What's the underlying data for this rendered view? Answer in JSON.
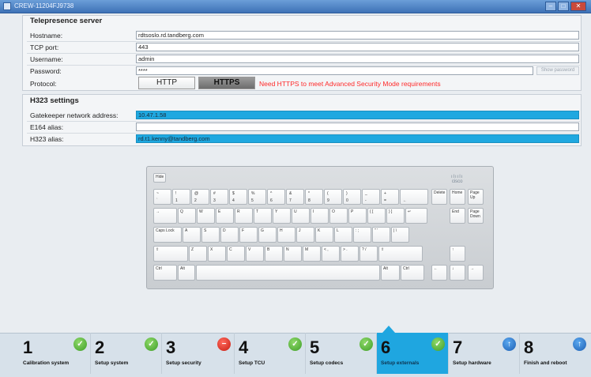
{
  "window": {
    "title": "CREW-11204FJ9738"
  },
  "telepresence": {
    "title": "Telepresence server",
    "hostname_label": "Hostname:",
    "hostname_value": "rdtsoslo.rd.tandberg.com",
    "tcp_label": "TCP port:",
    "tcp_value": "443",
    "username_label": "Username:",
    "username_value": "admin",
    "password_label": "Password:",
    "password_value": "****",
    "show_password": "Show password",
    "protocol_label": "Protocol:",
    "http": "HTTP",
    "https": "HTTPS",
    "protocol_selected": "HTTPS",
    "warning": "Need HTTPS to meet Advanced Security Mode requirements"
  },
  "h323": {
    "title": "H323 settings",
    "gatekeeper_label": "Gatekeeper network address:",
    "gatekeeper_value": "10.47.1.58",
    "e164_label": "E164 alias:",
    "e164_value": "",
    "h323_label": "H323 alias:",
    "h323_value": "rd.t1.kenny@tandberg.com"
  },
  "keyboard": {
    "hide": "Hide",
    "logo": "cisco",
    "row1": [
      [
        "~",
        "`"
      ],
      [
        "!",
        "1"
      ],
      [
        "@",
        "2"
      ],
      [
        "#",
        "3"
      ],
      [
        "$",
        "4"
      ],
      [
        "%",
        "5"
      ],
      [
        "^",
        "6"
      ],
      [
        "&",
        "7"
      ],
      [
        "*",
        "8"
      ],
      [
        "(",
        "9"
      ],
      [
        ")",
        "0"
      ],
      [
        "_",
        "-"
      ],
      [
        "+",
        "="
      ],
      [
        "",
        "←"
      ]
    ],
    "row2": [
      "→",
      "Q",
      "W",
      "E",
      "R",
      "T",
      "Y",
      "U",
      "I",
      "O",
      "P",
      "{ [",
      "} ]",
      "↵"
    ],
    "row3": [
      "Caps Lock",
      "A",
      "S",
      "D",
      "F",
      "G",
      "H",
      "J",
      "K",
      "L",
      ": ;",
      "\" '",
      "| \\"
    ],
    "row4": [
      "⇧",
      "Z",
      "X",
      "C",
      "V",
      "B",
      "N",
      "M",
      "< ,",
      "> .",
      "? /",
      "⇧"
    ],
    "row5": [
      "Ctrl",
      "Alt",
      "",
      "Alt",
      "Ctrl"
    ],
    "nav": {
      "delete": "Delete",
      "home": "Home",
      "pageup": "Page Up",
      "end": "End",
      "pagedown": "Page Down"
    },
    "arrows": {
      "up": "↑",
      "left": "←",
      "down": "↓",
      "right": "→"
    }
  },
  "wizard": {
    "steps": [
      {
        "num": "1",
        "label": "Calibration system",
        "status": "ok",
        "status_icon": "check-icon"
      },
      {
        "num": "2",
        "label": "Setup system",
        "status": "ok",
        "status_icon": "check-icon"
      },
      {
        "num": "3",
        "label": "Setup security",
        "status": "error",
        "status_icon": "minus-icon"
      },
      {
        "num": "4",
        "label": "Setup TCU",
        "status": "ok",
        "status_icon": "check-icon"
      },
      {
        "num": "5",
        "label": "Setup codecs",
        "status": "ok",
        "status_icon": "check-icon"
      },
      {
        "num": "6",
        "label": "Setup externals",
        "status": "ok",
        "status_icon": "check-icon",
        "active": true
      },
      {
        "num": "7",
        "label": "Setup hardware",
        "status": "pending",
        "status_icon": "arrow-up-icon"
      },
      {
        "num": "8",
        "label": "Finish and reboot",
        "status": "pending",
        "status_icon": "arrow-up-icon"
      }
    ]
  },
  "colors": {
    "highlight": "#1fa8e0",
    "warning": "#ff2a2a",
    "ok": "#3e9e27",
    "error": "#c81e12",
    "pending": "#1d5fb3"
  }
}
